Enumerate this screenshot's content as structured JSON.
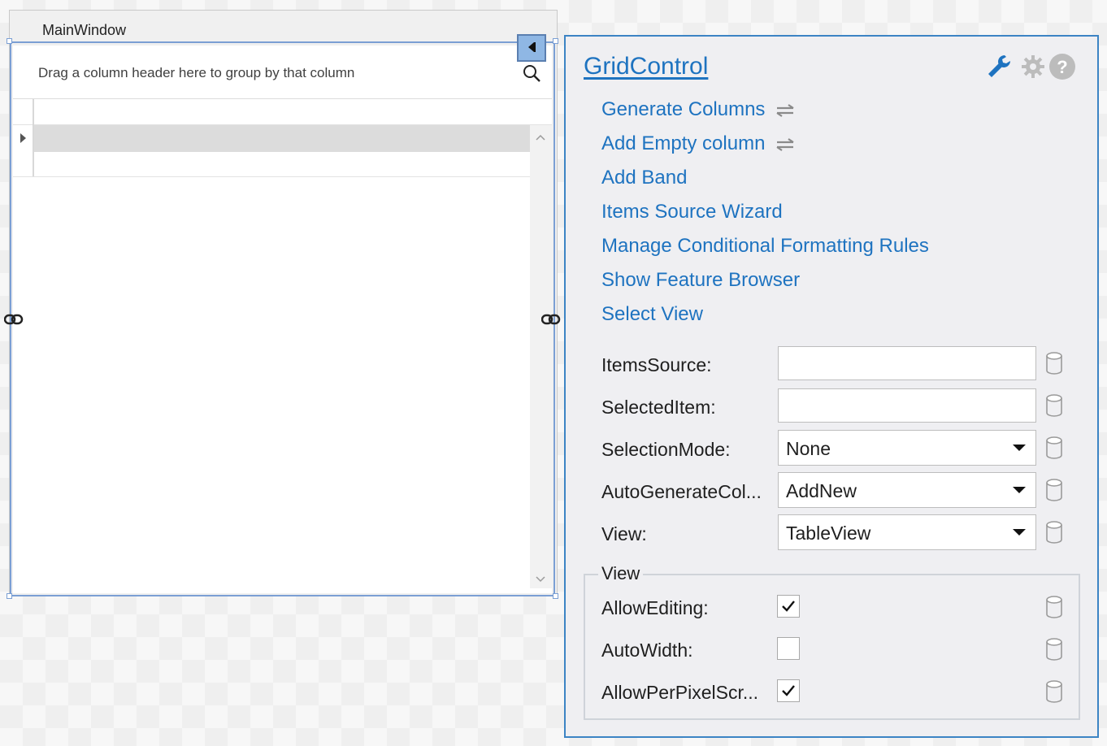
{
  "window": {
    "title": "MainWindow"
  },
  "grid": {
    "group_panel_text": "Drag a column header here to group by that column"
  },
  "panel": {
    "title": "GridControl",
    "header_icons": [
      "wrench-icon",
      "gear-icon",
      "help-icon"
    ],
    "actions": [
      {
        "label": "Generate Columns",
        "icon": "swap-icon"
      },
      {
        "label": "Add Empty column",
        "icon": "swap-icon"
      },
      {
        "label": "Add Band"
      },
      {
        "label": "Items Source Wizard"
      },
      {
        "label": "Manage Conditional Formatting Rules"
      },
      {
        "label": "Show Feature Browser"
      },
      {
        "label": "Select View"
      }
    ],
    "properties": [
      {
        "label": "ItemsSource:",
        "value": ""
      },
      {
        "label": "SelectedItem:",
        "value": ""
      },
      {
        "label": "SelectionMode:",
        "value": "None"
      },
      {
        "label": "AutoGenerateCol...",
        "value": "AddNew"
      },
      {
        "label": "View:",
        "value": "TableView"
      }
    ],
    "view_group": {
      "title": "View",
      "options": [
        {
          "label": "AllowEditing:",
          "checked": true
        },
        {
          "label": "AutoWidth:",
          "checked": false
        },
        {
          "label": "AllowPerPixelScr...",
          "checked": true
        }
      ]
    }
  },
  "colors": {
    "accent": "#1e73c0",
    "selection": "#7b9fd4",
    "panel_border": "#3c84c4"
  }
}
